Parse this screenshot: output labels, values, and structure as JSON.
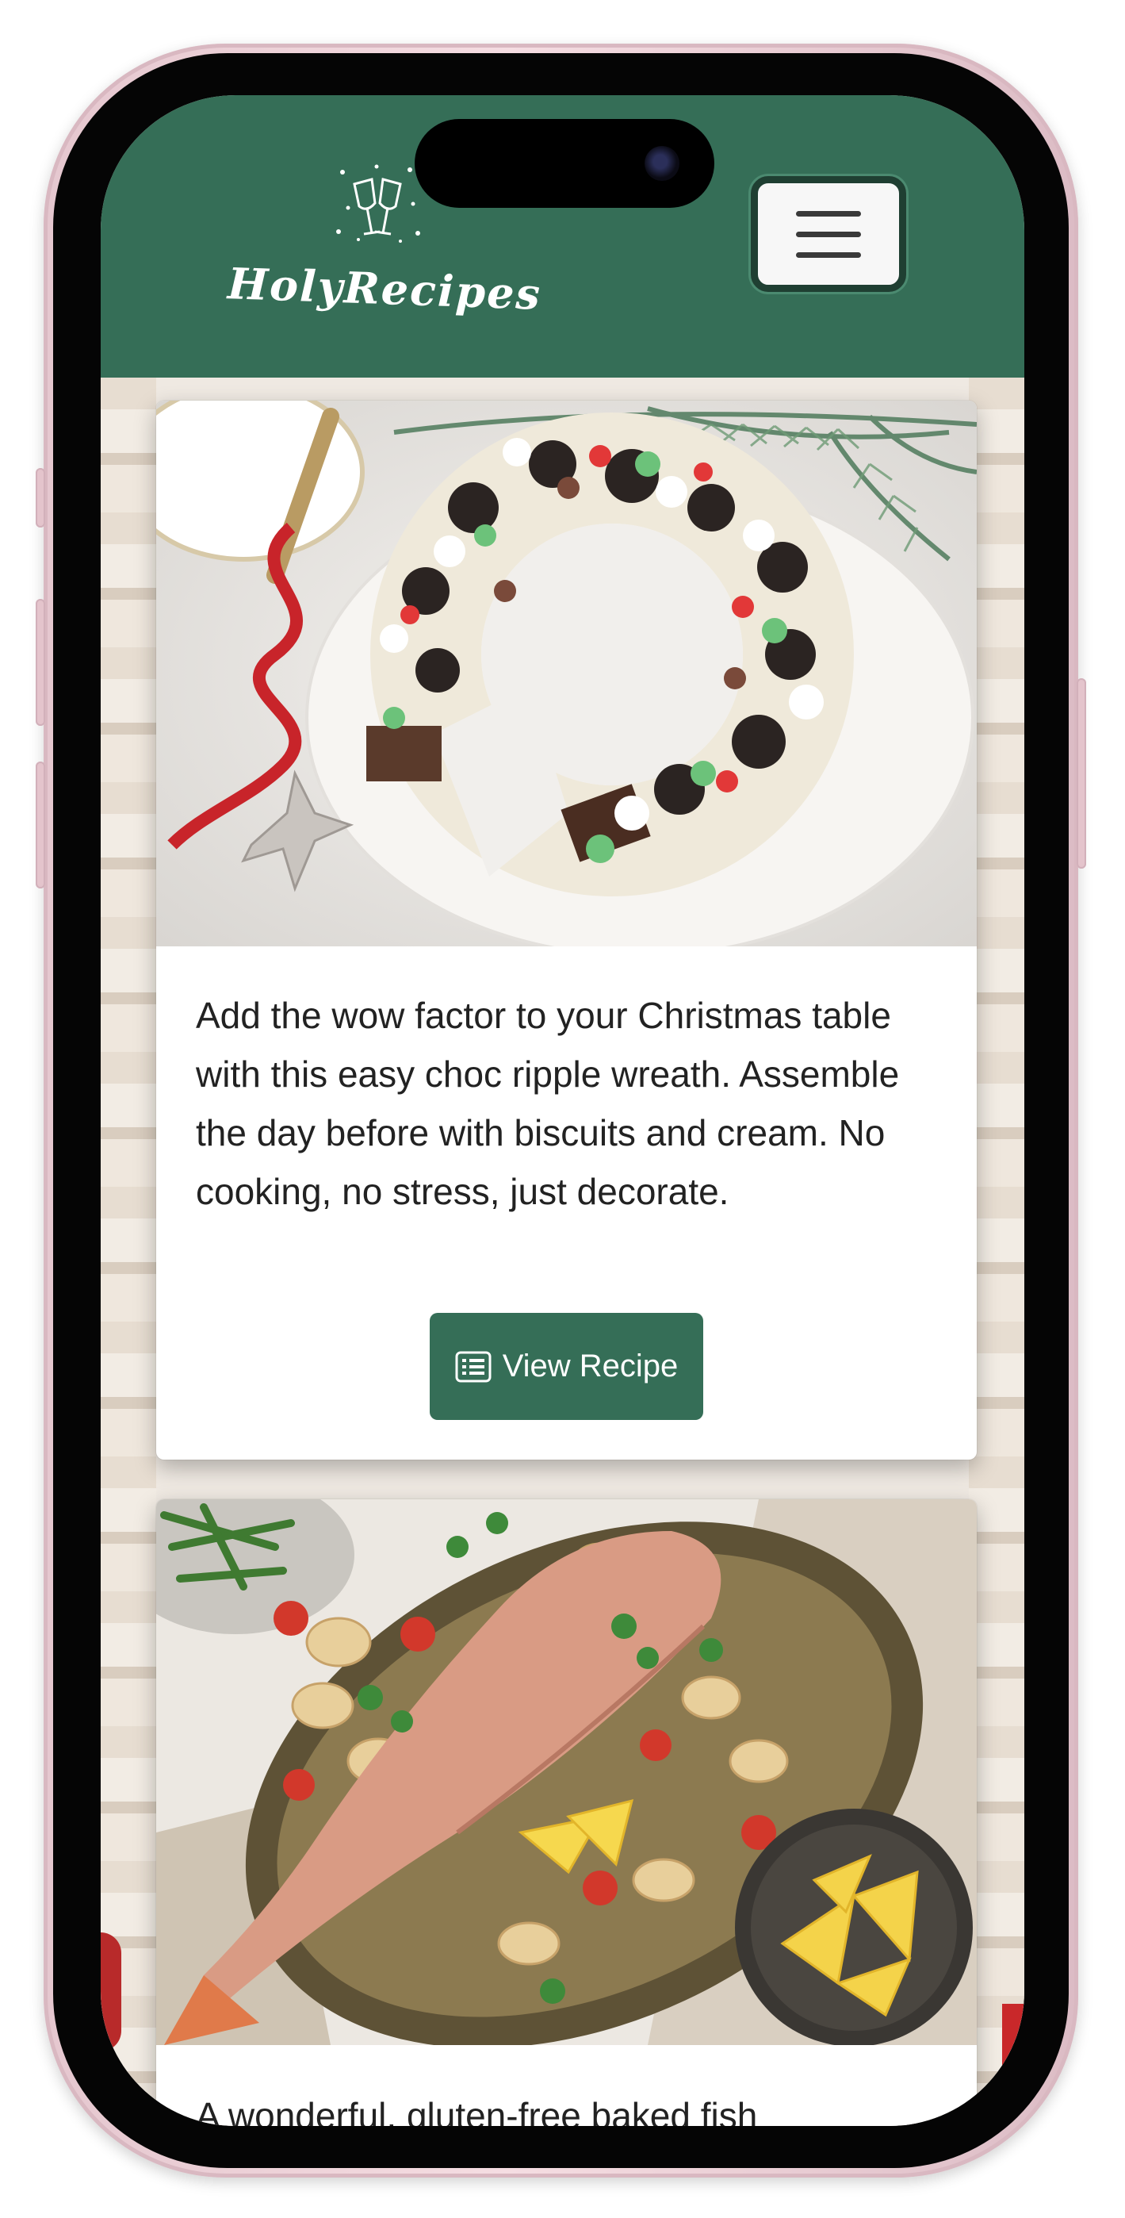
{
  "app": {
    "name": "HolyRecipes"
  },
  "header": {
    "menu_icon": "hamburger-icon",
    "logo_icon": "champagne-glasses-icon"
  },
  "colors": {
    "brand": "#356e57",
    "button_text": "#ffffff",
    "card_bg": "#ffffff"
  },
  "recipes": [
    {
      "image": "choc ripple wreath cake",
      "description": "Add the wow factor to your Christmas table with this easy choc ripple wreath. Assemble the day before with biscuits and cream. No cooking, no stress, just decorate.",
      "button_label": "View Recipe",
      "button_icon": "list-icon"
    },
    {
      "image": "baked fish with potatoes and lemon",
      "description": "A wonderful, gluten-free baked fish"
    }
  ]
}
